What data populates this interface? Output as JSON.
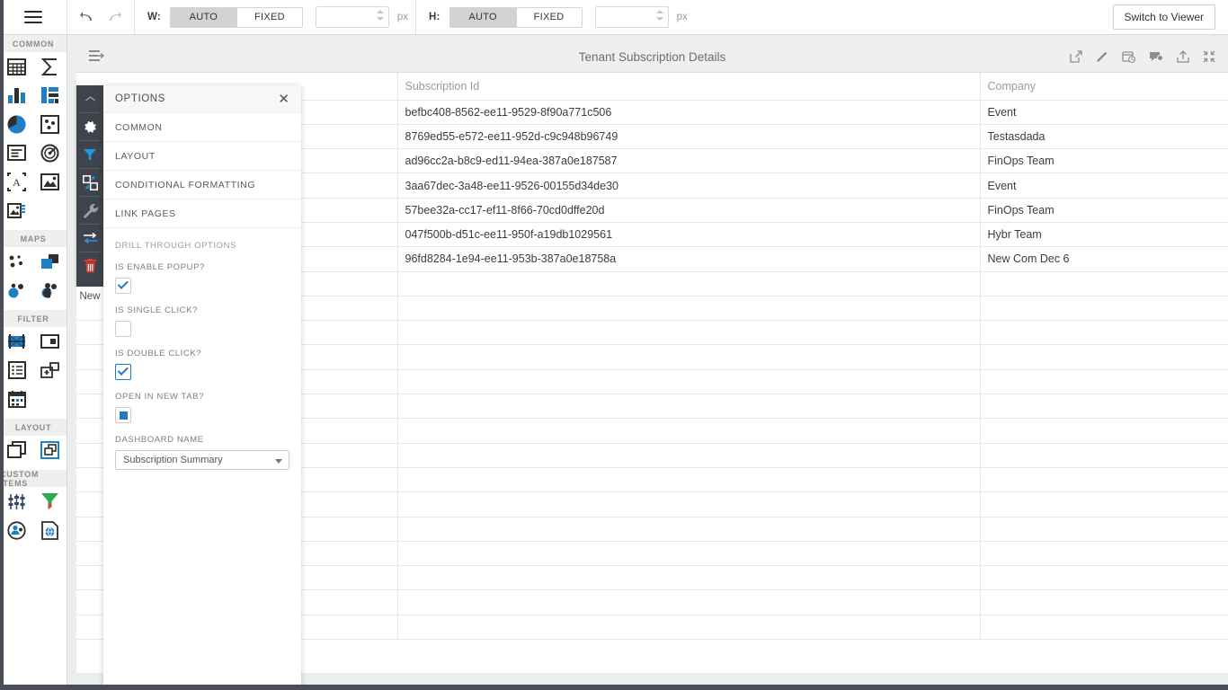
{
  "toolbar": {
    "menu_icon": "hamburger-icon",
    "undo_icon": "undo-icon",
    "redo_icon": "redo-icon",
    "width_label": "W:",
    "height_label": "H:",
    "seg_auto": "AUTO",
    "seg_fixed": "FIXED",
    "width_value": "",
    "height_value": "",
    "unit": "px",
    "switch_viewer": "Switch to Viewer"
  },
  "palette": {
    "sections": [
      {
        "title": "COMMON",
        "items": [
          {
            "name": "table-widget-icon"
          },
          {
            "name": "sum-widget-icon"
          },
          {
            "name": "bar-chart-widget-icon"
          },
          {
            "name": "combo-chart-widget-icon"
          },
          {
            "name": "pie-chart-widget-icon"
          },
          {
            "name": "scatter-widget-icon"
          },
          {
            "name": "card-widget-icon"
          },
          {
            "name": "gauge-widget-icon"
          },
          {
            "name": "text-widget-icon"
          },
          {
            "name": "image-widget-icon"
          },
          {
            "name": "image-list-widget-icon"
          }
        ]
      },
      {
        "title": "MAPS",
        "items": [
          {
            "name": "bubble-map-icon"
          },
          {
            "name": "layer-map-icon"
          },
          {
            "name": "cluster-map-icon"
          },
          {
            "name": "heat-map-icon"
          }
        ]
      },
      {
        "title": "FILTER",
        "items": [
          {
            "name": "range-filter-icon"
          },
          {
            "name": "dropdown-filter-icon"
          },
          {
            "name": "list-filter-icon"
          },
          {
            "name": "panel-filter-icon"
          },
          {
            "name": "date-filter-icon"
          }
        ]
      },
      {
        "title": "LAYOUT",
        "items": [
          {
            "name": "container-icon"
          },
          {
            "name": "group-container-icon"
          }
        ]
      },
      {
        "title": "CUSTOM ITEMS",
        "items": [
          {
            "name": "sliders-icon"
          },
          {
            "name": "funnel-icon"
          },
          {
            "name": "user-network-icon"
          },
          {
            "name": "web-page-icon"
          }
        ]
      }
    ]
  },
  "toolstrip": {
    "items": [
      {
        "name": "collapse-chevron-up-icon",
        "active": false
      },
      {
        "name": "settings-gear-icon",
        "active": false
      },
      {
        "name": "filter-icon",
        "active": false
      },
      {
        "name": "duplicate-icon",
        "active": false
      },
      {
        "name": "wrench-icon",
        "active": true
      },
      {
        "name": "swap-arrows-icon",
        "active": false
      },
      {
        "name": "delete-trash-icon",
        "active": false
      }
    ],
    "new_label": "New"
  },
  "widget": {
    "title": "Tenant Subscription Details",
    "left_icon": "indent-list-icon",
    "right_icons": [
      {
        "name": "open-external-icon"
      },
      {
        "name": "edit-pencil-icon"
      },
      {
        "name": "schedule-calendar-icon"
      },
      {
        "name": "comment-icon"
      },
      {
        "name": "export-upload-icon"
      },
      {
        "name": "collapse-fullscreen-icon"
      }
    ],
    "drag_handle": "drag-handle-icon"
  },
  "table": {
    "columns": [
      "",
      "Subscription Id",
      "Company"
    ],
    "rows": [
      [
        "",
        "befbc408-8562-ee11-9529-8f90a771c506",
        "Event"
      ],
      [
        "",
        "8769ed55-e572-ee11-952d-c9c948b96749",
        "Testasdada"
      ],
      [
        "",
        "ad96cc2a-b8c9-ed11-94ea-387a0e187587",
        "FinOps Team"
      ],
      [
        "",
        "3aa67dec-3a48-ee11-9526-00155d34de30",
        "Event"
      ],
      [
        "",
        "57bee32a-cc17-ef11-8f66-70cd0dffe20d",
        "FinOps Team"
      ],
      [
        "",
        "047f500b-d51c-ee11-950f-a19db1029561",
        "Hybr Team"
      ],
      [
        "",
        "96fd8284-1e94-ee11-953b-387a0e18758a",
        "New Com Dec 6"
      ]
    ],
    "empty_rows": 15
  },
  "options_panel": {
    "title": "OPTIONS",
    "close_icon": "close-icon",
    "menu": [
      {
        "label": "COMMON"
      },
      {
        "label": "LAYOUT"
      },
      {
        "label": "CONDITIONAL FORMATTING"
      },
      {
        "label": "LINK PAGES"
      }
    ],
    "drill": {
      "section_title": "DRILL THROUGH OPTIONS",
      "enable_popup_label": "IS ENABLE POPUP?",
      "enable_popup_state": "checked",
      "single_click_label": "IS SINGLE CLICK?",
      "single_click_state": "unchecked",
      "double_click_label": "IS DOUBLE CLICK?",
      "double_click_state": "checked-active",
      "new_tab_label": "OPEN IN NEW TAB?",
      "new_tab_state": "indeterminate",
      "dashboard_name_label": "DASHBOARD NAME",
      "dashboard_name_value": "Subscription Summary"
    }
  },
  "colors": {
    "accent_blue": "#2079c7",
    "dark_chrome": "#4a4f57",
    "toolstrip_bg": "#3f444c",
    "trash_red": "#d9534f"
  }
}
